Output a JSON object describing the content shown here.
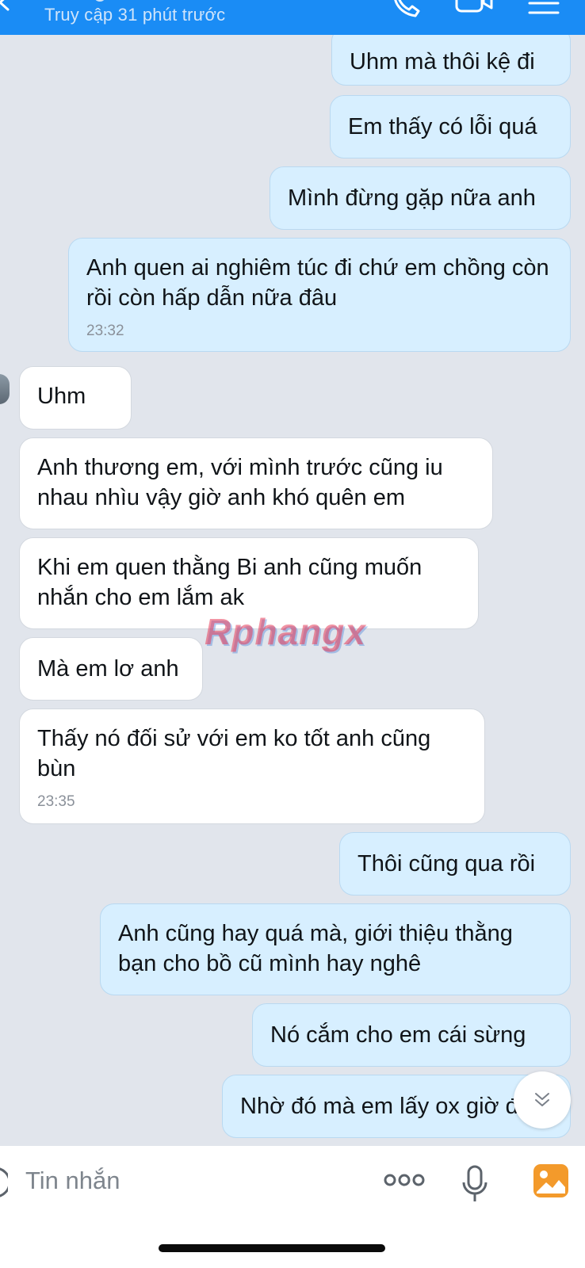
{
  "header": {
    "status": "Truy cập 31 phút trước",
    "icons": [
      "back-icon",
      "phone-icon",
      "video-icon",
      "menu-icon"
    ]
  },
  "messages": [
    {
      "id": "m1",
      "direction": "out",
      "text": "Uhm mà thôi kệ đi"
    },
    {
      "id": "m2",
      "direction": "out",
      "text": "Em thấy có lỗi quá"
    },
    {
      "id": "m3",
      "direction": "out",
      "text": "Mình đừng gặp nữa anh"
    },
    {
      "id": "m4",
      "direction": "out",
      "text": "Anh quen ai nghiêm túc đi chứ em chồng còn rồi còn hấp dẫn nữa đâu",
      "time": "23:32"
    },
    {
      "id": "m5",
      "direction": "in",
      "text": "Uhm"
    },
    {
      "id": "m6",
      "direction": "in",
      "text": "Anh thương em, với mình trước cũng iu nhau nhìu vậy giờ anh khó quên em"
    },
    {
      "id": "m7",
      "direction": "in",
      "text": "Khi em quen thằng Bi anh cũng muốn nhắn cho em lắm ak"
    },
    {
      "id": "m8",
      "direction": "in",
      "text": "Mà em lơ anh"
    },
    {
      "id": "m9",
      "direction": "in",
      "text": "Thấy nó đối sử với em ko tốt anh cũng bùn",
      "time": "23:35"
    },
    {
      "id": "m10",
      "direction": "out",
      "text": "Thôi cũng qua rồi"
    },
    {
      "id": "m11",
      "direction": "out",
      "text": "Anh cũng hay quá mà, giới thiệu thằng bạn cho bồ cũ mình hay nghê"
    },
    {
      "id": "m12",
      "direction": "out",
      "text": "Nó cắm cho em cái sừng"
    },
    {
      "id": "m13",
      "direction": "out",
      "text": "Nhờ đó mà em lấy ox giờ đó"
    }
  ],
  "watermark": "Rphangx",
  "composer": {
    "placeholder": "Tin nhắn",
    "icons": [
      "emoji-icon",
      "more-icon",
      "mic-icon",
      "image-icon"
    ]
  },
  "colors": {
    "header": "#1a8cf5",
    "chat_background": "#e1e5ec",
    "outgoing_bubble": "#d7efff",
    "incoming_bubble": "#ffffff",
    "image_icon": "#f39a2b"
  }
}
